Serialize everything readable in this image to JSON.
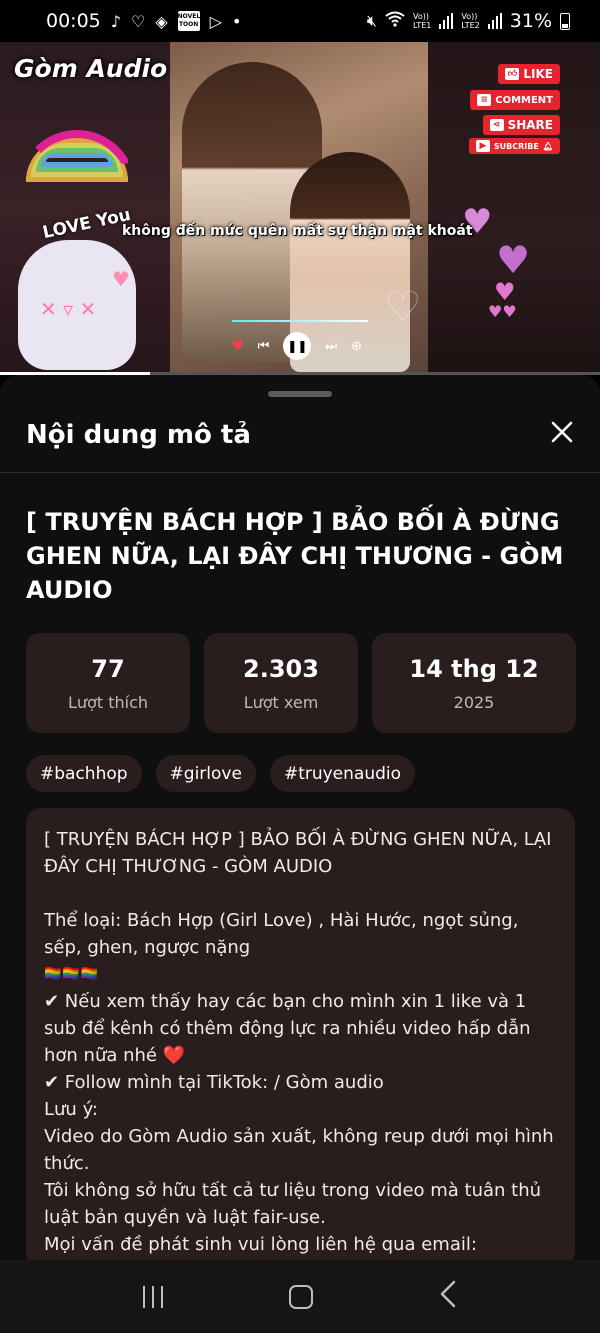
{
  "status_bar": {
    "time": "00:05",
    "left_icons": [
      "tiktok-icon",
      "messenger-icon",
      "app-icon",
      "novel-toon-icon",
      "play-icon",
      "dot-icon"
    ],
    "novel_badge": "NOVEL TOON",
    "sim1_top": "Vo))",
    "sim1_bottom": "LTE1",
    "sim2_top": "Vo))",
    "sim2_bottom": "LTE2",
    "battery": "31%"
  },
  "video": {
    "brand": "Gòm Audio",
    "love_text": "LOVE You",
    "subtitle": "không đến mức quên mất sự thận mật khoát",
    "buttons": {
      "like": "LIKE",
      "comment": "COMMENT",
      "share": "SHARE",
      "subscribe": "SUBCRIBE"
    },
    "progress": 0.25
  },
  "sheet": {
    "title": "Nội dung mô tả",
    "video_title": "[ TRUYỆN BÁCH HỢP ] BẢO BỐI À ĐỪNG GHEN NỮA, LẠI ĐÂY CHỊ THƯƠNG - GÒM AUDIO",
    "stats": [
      {
        "value": "77",
        "label": "Lượt thích"
      },
      {
        "value": "2.303",
        "label": "Lượt xem"
      },
      {
        "value": "14 thg 12",
        "label": "2025"
      }
    ],
    "tags": [
      "#bachhop",
      "#girlove",
      "#truyenaudio"
    ],
    "description": {
      "line1": "[ TRUYỆN BÁCH HỢP ] BẢO BỐI À ĐỪNG GHEN NỮA, LẠI ĐÂY CHỊ THƯƠNG - GÒM AUDIO",
      "line2": "Thể loại: Bách Hợp (Girl Love) , Hài Hước, ngọt sủng, sếp, ghen, ngược nặng",
      "flags": "🏳️‍🌈🏳️‍🌈🏳️‍🌈",
      "line3": "✔ Nếu xem thấy hay các bạn cho mình xin 1 like và 1 sub để kênh có thêm động lực ra nhiều video hấp dẫn hơn nữa nhé ❤️",
      "line4": "✔ Follow mình tại TikTok:   / Gòm audio",
      "line5": "Lưu ý:",
      "line6": "Video do Gòm Audio sản xuất, không reup dưới mọi hình thức.",
      "line7": "Tôi không sở hữu tất cả tư liệu trong video mà tuân thủ luật bản quyền và luật fair-use.",
      "line8": "Mọi vấn đề phát sinh vui lòng liên hệ qua email:"
    }
  },
  "colors": {
    "sheet_bg": "#0f0f0f",
    "card_bg": "#2a1d1d",
    "accent_red": "#e6242d"
  }
}
